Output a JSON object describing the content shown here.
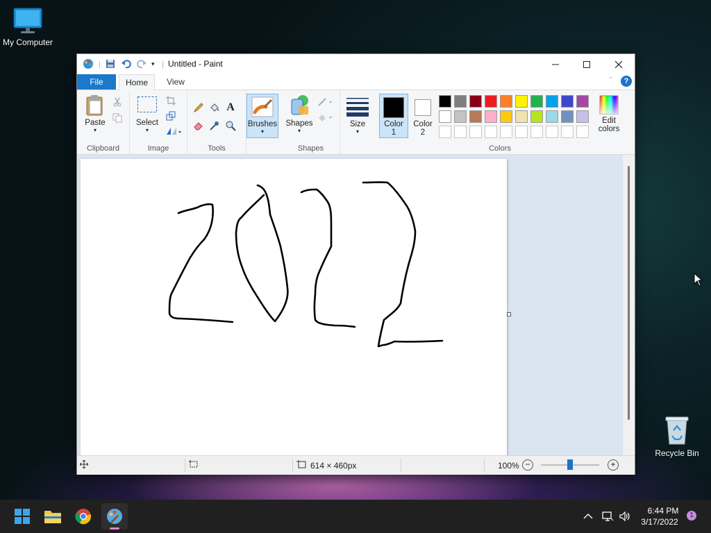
{
  "desktop": {
    "my_computer_label": "My Computer",
    "recycle_bin_label": "Recycle Bin"
  },
  "window": {
    "title": "Untitled - Paint",
    "tabs": {
      "file": "File",
      "home": "Home",
      "view": "View"
    }
  },
  "ribbon": {
    "clipboard": {
      "paste": "Paste",
      "group": "Clipboard"
    },
    "image": {
      "select": "Select",
      "group": "Image"
    },
    "tools": {
      "group": "Tools",
      "text_glyph": "A"
    },
    "brushes": {
      "label": "Brushes"
    },
    "shapes": {
      "label": "Shapes",
      "group": "Shapes"
    },
    "size": {
      "label": "Size"
    },
    "colors": {
      "color1_label": "Color\n1",
      "color1_l1": "Color",
      "color1_l2": "1",
      "color2_l1": "Color",
      "color2_l2": "2",
      "edit_l1": "Edit",
      "edit_l2": "colors",
      "group": "Colors",
      "color1": "#000000",
      "color2": "#ffffff",
      "palette_row1": [
        "#000000",
        "#7f7f7f",
        "#880015",
        "#ed1c24",
        "#ff7f27",
        "#fff200",
        "#22b14c",
        "#00a2e8",
        "#3f48cc",
        "#a349a4"
      ],
      "palette_row2": [
        "#ffffff",
        "#c3c3c3",
        "#b97a57",
        "#ffaec9",
        "#ffc90e",
        "#efe4b0",
        "#b5e61d",
        "#99d9ea",
        "#7092be",
        "#c8bfe7"
      ],
      "palette_row3": [
        "#ffffff",
        "#ffffff",
        "#ffffff",
        "#ffffff",
        "#ffffff",
        "#ffffff",
        "#ffffff",
        "#ffffff",
        "#ffffff",
        "#ffffff"
      ]
    }
  },
  "canvas": {
    "drawing_text": "2022"
  },
  "status": {
    "dimensions": "614 × 460px",
    "zoom": "100%",
    "zoom_level": 0.5
  },
  "taskbar": {
    "time": "6:44 PM",
    "date": "3/17/2022",
    "notification_count": "1"
  }
}
